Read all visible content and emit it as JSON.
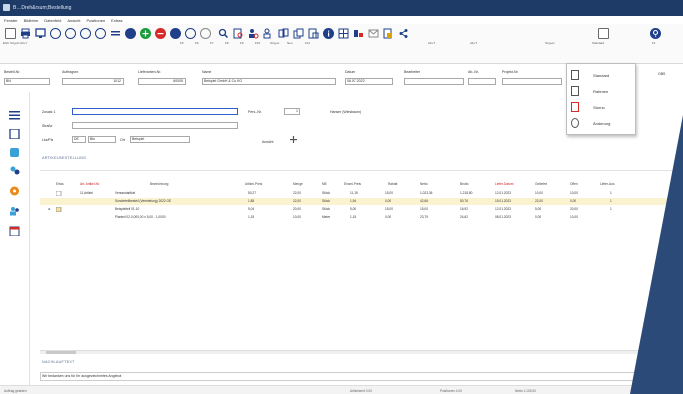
{
  "window": {
    "title": "B…Dreh&rsum;Bestellung"
  },
  "menu": [
    "Fenster",
    "Bildbtrm",
    "Datenfeld",
    "Ansicht",
    "Positionen",
    "Extras"
  ],
  "toolbar": {
    "labels": [
      {
        "id": "tb-esc",
        "text": "ESC  Strg+D  Alt+Y"
      },
      {
        "id": "tb-f5",
        "text": "F5"
      },
      {
        "id": "tb-f6",
        "text": "F6"
      },
      {
        "id": "tb-f7",
        "text": "F7"
      },
      {
        "id": "tb-f8",
        "text": "F8"
      },
      {
        "id": "tb-f9",
        "text": "F9"
      },
      {
        "id": "tb-f10",
        "text": "F10"
      },
      {
        "id": "tb-strga",
        "text": "Strg+A"
      },
      {
        "id": "tb-neu",
        "text": "Neu"
      },
      {
        "id": "tb-f11",
        "text": "F11"
      },
      {
        "id": "tb-altt",
        "text": "Alt+T"
      },
      {
        "id": "tb-altt2",
        "text": "Alt+T"
      },
      {
        "id": "tb-strg",
        "text": "Strg+H"
      },
      {
        "id": "tb-std",
        "text": "Standard"
      },
      {
        "id": "tb-f1",
        "text": "F1"
      }
    ]
  },
  "header_fields": {
    "bestell_nr_label": "Bestell-Nr.",
    "bestell_nr_value": "BN",
    "auftragsnr_label": "Auftragsnr.",
    "auftragsnr_value": "1012",
    "lieferanten_label": "Lieferanten-Nr.",
    "lieferanten_value": "60005",
    "name_label": "Name",
    "name_value": "Beispiel GmbH & Co KG",
    "datum_label": "Datum",
    "datum_value": "06.07.2022",
    "bearbeiter_label": "Bearbeiter",
    "bearbeiter_value": "",
    "ab_nr_label": "Ab.-Nr.",
    "projekt_label": "Projekt-Nr."
  },
  "detail_fields": {
    "zusatz_label": "Zusatz 1",
    "strasse_label": "Straße",
    "plz_label": "Lkz/Plz",
    "plz_value": "DE",
    "plz2_value": "Bln",
    "ort_label": "Ort",
    "ort_value": "Beispiel",
    "pers_label": "Pers.-Nr.",
    "pers_value": "1",
    "ansprech_value": "Hanser (Wiesbaum)",
    "ansicht_label": "Ansicht"
  },
  "section_positions": "ARTIKELBESTELLUNG",
  "section_footer": "NACHLAUFTEXT",
  "footer_text": "Wir bedanken uns für Ihr ausgezeichnetes Angebot",
  "table": {
    "headers": [
      "Erfas.",
      "Art. Artikel-Nr.",
      "Bezeichnung",
      "Artikel-Preis",
      "Menge",
      "ME",
      "Einzel-Preis",
      "Rabatt",
      "Netto",
      "Brutto",
      "Liefer-Datum",
      "Geliefert",
      "Offen",
      "Liefer-Aus"
    ],
    "rows": [
      {
        "art": "11 Artikel",
        "bez": "Versandartikel",
        "preis": "50,27",
        "menge": "22,00",
        "me": "Stück",
        "ep": "11,15",
        "rab": "15,00",
        "netto": "1.023,36",
        "brutto": "1.218,80",
        "datum": "12.01.2023",
        "gel": "10,00",
        "off": "10,00",
        "la": "1",
        "sel": false
      },
      {
        "art": "",
        "bez": "Sonderteilbestell (Vermietung) 2022 GE",
        "preis": "1,85",
        "menge": "22,00",
        "me": "Stück",
        "ep": "1,94",
        "rab": "0,00",
        "netto": "42,66",
        "brutto": "50,76",
        "datum": "15.01.2023",
        "gel": "22,00",
        "off": "0,00",
        "la": "1",
        "sel": true
      },
      {
        "art": "",
        "bez": "Beispielteil 01-10",
        "preis": "5,04",
        "menge": "20,00",
        "me": "Stück",
        "ep": "5,00",
        "rab": "15,00",
        "netto": "15,00",
        "brutto": "16,92",
        "datum": "12.01.2023",
        "gel": "5,00",
        "off": "20,00",
        "la": "1",
        "sel": false
      },
      {
        "art": "",
        "bez": "Planteil 02-0,000,00 x 5,00 - 1,0000",
        "preis": "1,15",
        "menge": "10,00",
        "me": "Meter",
        "ep": "1,15",
        "rab": "0,00",
        "netto": "23,79",
        "brutto": "24,62",
        "datum": "08.01.2023",
        "gel": "0,00",
        "off": "10,00",
        "la": "",
        "sel": false
      }
    ]
  },
  "dropdown": {
    "title": "Standard",
    "items": [
      "Standard",
      "Rahmen",
      "Storno",
      "Änderung"
    ]
  },
  "status": {
    "left": "Auftrag geladen",
    "seg1": "Artikelwert 0,00",
    "seg2": "Positionen 4,00",
    "seg3": "Netto 1.105,00"
  },
  "right_label": "OBS",
  "colors": {
    "titlebar": "#1e3a66",
    "accent_blue": "#1f3f8a",
    "overlay": "#2c4a77",
    "red": "#c32020",
    "selected_row": "#fbf3cf"
  }
}
